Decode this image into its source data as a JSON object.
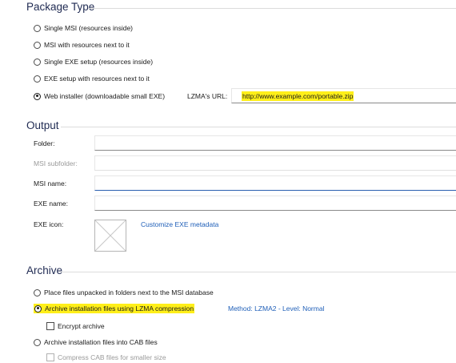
{
  "package": {
    "title": "Package Type",
    "options": [
      {
        "label": "Single MSI (resources inside)",
        "selected": false
      },
      {
        "label": "MSI with resources next to it",
        "selected": false
      },
      {
        "label": "Single EXE setup (resources inside)",
        "selected": false
      },
      {
        "label": "EXE setup with resources next to it",
        "selected": false
      },
      {
        "label": "Web installer (downloadable small EXE)",
        "selected": true
      }
    ],
    "url_label": "LZMA's URL:",
    "url_value": "http://www.example.com/portable.zip"
  },
  "output": {
    "title": "Output",
    "folder_label": "Folder:",
    "msi_subfolder_label": "MSI subfolder:",
    "msi_name_label": "MSI name:",
    "exe_name_label": "EXE name:",
    "exe_icon_label": "EXE icon:",
    "customize_link": "Customize EXE metadata"
  },
  "archive": {
    "title": "Archive",
    "opt_unpacked": "Place files unpacked in folders next to the MSI database",
    "opt_lzma": "Archive installation files using LZMA compression",
    "method_link": "Method: LZMA2 - Level: Normal",
    "encrypt": "Encrypt archive",
    "opt_cab": "Archive installation files into CAB files",
    "compress_cab": "Compress CAB files for smaller size"
  },
  "colors": {
    "highlight": "#ffef1a",
    "link": "#1f5fb8",
    "section_title": "#1f2a52"
  }
}
